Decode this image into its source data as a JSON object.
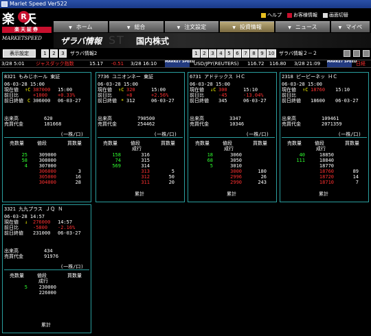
{
  "window": {
    "title": "Marlet Speed Ver522"
  },
  "logo": {
    "big": "楽天",
    "mark": "R",
    "sub": "楽天証券",
    "product": "MARKETSPEED"
  },
  "top_links": [
    {
      "label": "ヘルプ",
      "icon": "help-icon"
    },
    {
      "label": "お客様情報",
      "icon": "user-icon"
    },
    {
      "label": "画面切替",
      "icon": "screen-switch-icon"
    }
  ],
  "nav": [
    {
      "label": "ホーム"
    },
    {
      "label": "総合"
    },
    {
      "label": "注文設定"
    },
    {
      "label": "投資情報",
      "active": true
    },
    {
      "label": "ニュース"
    },
    {
      "label": "マイペ"
    }
  ],
  "banner": {
    "title": "ザラバ情報",
    "subtitle": "国内株式",
    "ghost": "ST"
  },
  "toolbar": {
    "setting_button": "表示設定",
    "pages": [
      "1",
      "2",
      "3"
    ],
    "label1": "ザラバ情報2",
    "pages2": [
      "1",
      "2",
      "3",
      "4",
      "5",
      "6",
      "7",
      "8",
      "9",
      "10"
    ],
    "label2": "ザラバ情報２－２"
  },
  "ticker": {
    "left1": "3/28 5:01",
    "label": "ジャスダック指数",
    "v1": "15.17",
    "v2": "-0.51",
    "time1": "3/28 16:10",
    "badge": "MARKET SPEED",
    "fx_label": "USD/JPY(REUTERS)",
    "fx1": "116.72",
    "fx2": "116.80",
    "fx_time": "3/28 21:09",
    "tail": "日経"
  },
  "panels": [
    {
      "header": "8321 もみじホール 東証",
      "date": "06-03-28 15:00",
      "price_label": "現在値",
      "price_mark": "↑C",
      "price": "387000",
      "time": "15:00",
      "chg_label": "前日比",
      "chg": "+1000",
      "chg_pct": "+0.33%",
      "prev_label": "前日終値",
      "prev_mark": "C",
      "prev": "306000",
      "prev_date": "06-03-27",
      "vol_label": "出来高",
      "vol": "620",
      "amt_label": "売買代金",
      "amt": "181668",
      "unit": "(一株/口)",
      "cols": [
        "売数量",
        "値段",
        "買数量"
      ],
      "sub_col": "",
      "rows": [
        {
          "sell": "25",
          "price": "309000",
          "buy": ""
        },
        {
          "sell": "58",
          "price": "308000",
          "buy": ""
        },
        {
          "sell": "4",
          "price": "307000",
          "buy": ""
        },
        {
          "sell": "",
          "price": "306000",
          "buy": "3"
        },
        {
          "sell": "",
          "price": "305000",
          "buy": "16"
        },
        {
          "sell": "",
          "price": "304000",
          "buy": "28"
        }
      ],
      "footer": ""
    },
    {
      "header": "7736 ユニオンネー 東証",
      "date": "06-03-28 15:00",
      "price_label": "現在値",
      "price_mark": "↑C",
      "price": "320",
      "time": "15:00",
      "chg_label": "前日比",
      "chg": "+8",
      "chg_pct": "+2.56%",
      "prev_label": "前日終値",
      "prev_mark": "*",
      "prev": "312",
      "prev_date": "06-03-27",
      "vol_label": "出来高",
      "vol": "790500",
      "amt_label": "売買代金",
      "amt": "254462",
      "unit": "(一株/口)",
      "cols": [
        "売数量",
        "値段",
        "買数量"
      ],
      "sub_col": "成行",
      "rows": [
        {
          "sell": "158",
          "price": "316",
          "buy": ""
        },
        {
          "sell": "74",
          "price": "315",
          "buy": ""
        },
        {
          "sell": "569",
          "price": "314",
          "buy": ""
        },
        {
          "sell": "",
          "price": "313",
          "buy": "5"
        },
        {
          "sell": "",
          "price": "312",
          "buy": "50"
        },
        {
          "sell": "",
          "price": "311",
          "buy": "20"
        }
      ],
      "footer": "累計"
    },
    {
      "header": "6731 アドテックス ＨＣ",
      "date": "06-03-28 15:00",
      "price_label": "現在値",
      "price_mark": "↓C",
      "price": "300",
      "time": "15:10",
      "chg_label": "前日比",
      "chg": "-45",
      "chg_pct": "-13.04%",
      "prev_label": "前日終値",
      "prev_mark": "",
      "prev": "345",
      "prev_date": "06-03-27",
      "vol_label": "出来高",
      "vol": "3347",
      "amt_label": "売買代金",
      "amt": "10346",
      "unit": "(一株/口)",
      "cols": [
        "売数量",
        "値段",
        "買数量"
      ],
      "sub_col": "成行",
      "rows": [
        {
          "sell": "18",
          "price": "3060",
          "buy": ""
        },
        {
          "sell": "68",
          "price": "3050",
          "buy": ""
        },
        {
          "sell": "5",
          "price": "3010",
          "buy": ""
        },
        {
          "sell": "",
          "price": "3000",
          "buy": "180"
        },
        {
          "sell": "",
          "price": "2996",
          "buy": "26"
        },
        {
          "sell": "",
          "price": "2990",
          "buy": "243"
        }
      ],
      "footer": "累計"
    },
    {
      "header": "2318 ビービーネッ ＨＣ",
      "date": "06-03-28 15:00",
      "price_label": "現在値",
      "price_mark": "↑C",
      "price": "18760",
      "time": "15:10",
      "chg_label": "前日比",
      "chg": "",
      "chg_pct": "",
      "prev_label": "前日終値",
      "prev_mark": "",
      "prev": "18600",
      "prev_date": "06-03-27",
      "vol_label": "出来高",
      "vol": "109461",
      "amt_label": "売買代金",
      "amt": "2071359",
      "unit": "(一株/口)",
      "cols": [
        "売数量",
        "値段",
        "買数量"
      ],
      "sub_col": "成行",
      "rows": [
        {
          "sell": "40",
          "price": "18850",
          "buy": ""
        },
        {
          "sell": "111",
          "price": "18840",
          "buy": ""
        },
        {
          "sell": "",
          "price": "18770",
          "buy": ""
        },
        {
          "sell": "",
          "price": "18760",
          "buy": "89"
        },
        {
          "sell": "",
          "price": "18720",
          "buy": "14"
        },
        {
          "sell": "",
          "price": "18710",
          "buy": "7"
        }
      ],
      "footer": "累計"
    },
    {
      "header": "3321 九九プラス ＪＱ Ｎ",
      "date": "06-03-28 14:57",
      "price_label": "現在値",
      "price_mark": "↓",
      "price": "276000",
      "time": "14:57",
      "chg_label": "前日比",
      "chg": "-5800",
      "chg_pct": "-2.16%",
      "prev_label": "前日終値",
      "prev_mark": "",
      "prev": "231000",
      "prev_date": "06-03-27",
      "vol_label": "出来高",
      "vol": "434",
      "amt_label": "売買代金",
      "amt": "91976",
      "unit": "(一株/口)",
      "cols": [
        "売数量",
        "値段",
        "買数量"
      ],
      "sub_col": "成行",
      "rows": [
        {
          "sell": "5",
          "price": "230000",
          "buy": ""
        },
        {
          "sell": "",
          "price": "226000",
          "buy": ""
        }
      ],
      "footer": "累計"
    }
  ]
}
